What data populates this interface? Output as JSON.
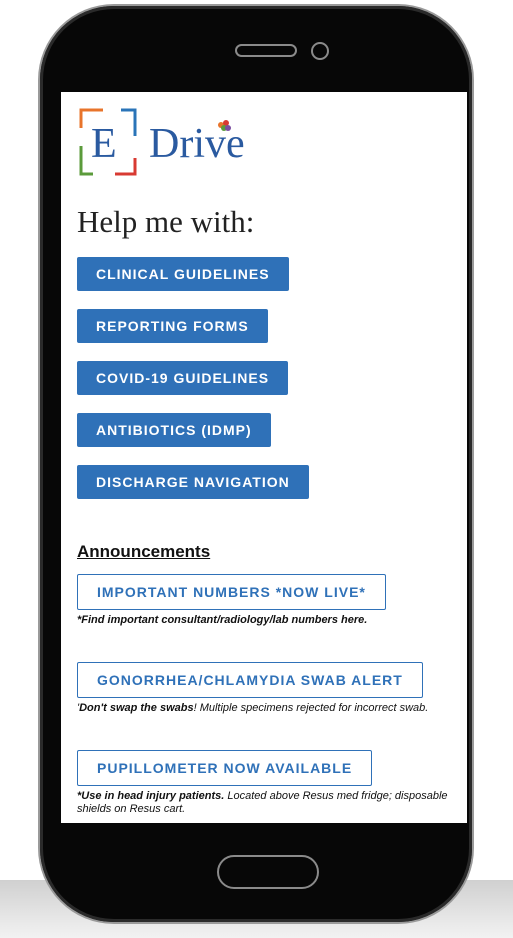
{
  "app": {
    "logo": {
      "letter": "E",
      "word": "Drive",
      "colors": [
        "#e8742b",
        "#5b9b3b",
        "#d83a32",
        "#2a74b8",
        "#7a4da0"
      ]
    },
    "help_title": "Help me with:"
  },
  "nav_buttons": [
    {
      "label": "CLINICAL GUIDELINES"
    },
    {
      "label": "REPORTING FORMS"
    },
    {
      "label": "COVID-19 GUIDELINES"
    },
    {
      "label": "ANTIBIOTICS (IDMP)"
    },
    {
      "label": "DISCHARGE NAVIGATION"
    }
  ],
  "announcements": {
    "heading": "Announcements",
    "items": [
      {
        "label": "IMPORTANT NUMBERS *NOW LIVE*",
        "note_bold": "*Find important consultant/radiology/lab numbers here.",
        "note_rest": ""
      },
      {
        "label": "GONORRHEA/CHLAMYDIA SWAB ALERT",
        "note_bold": "Don't swap the swabs",
        "note_rest": "! Multiple specimens rejected for incorrect swab.",
        "note_prefix": "'"
      },
      {
        "label": "PUPILLOMETER NOW AVAILABLE",
        "note_bold": "*Use in head injury patients.",
        "note_rest": " Located above Resus med fridge; disposable shields on Resus cart."
      }
    ]
  },
  "colors": {
    "primary": "#2f71b8",
    "phone_body": "#070707"
  }
}
